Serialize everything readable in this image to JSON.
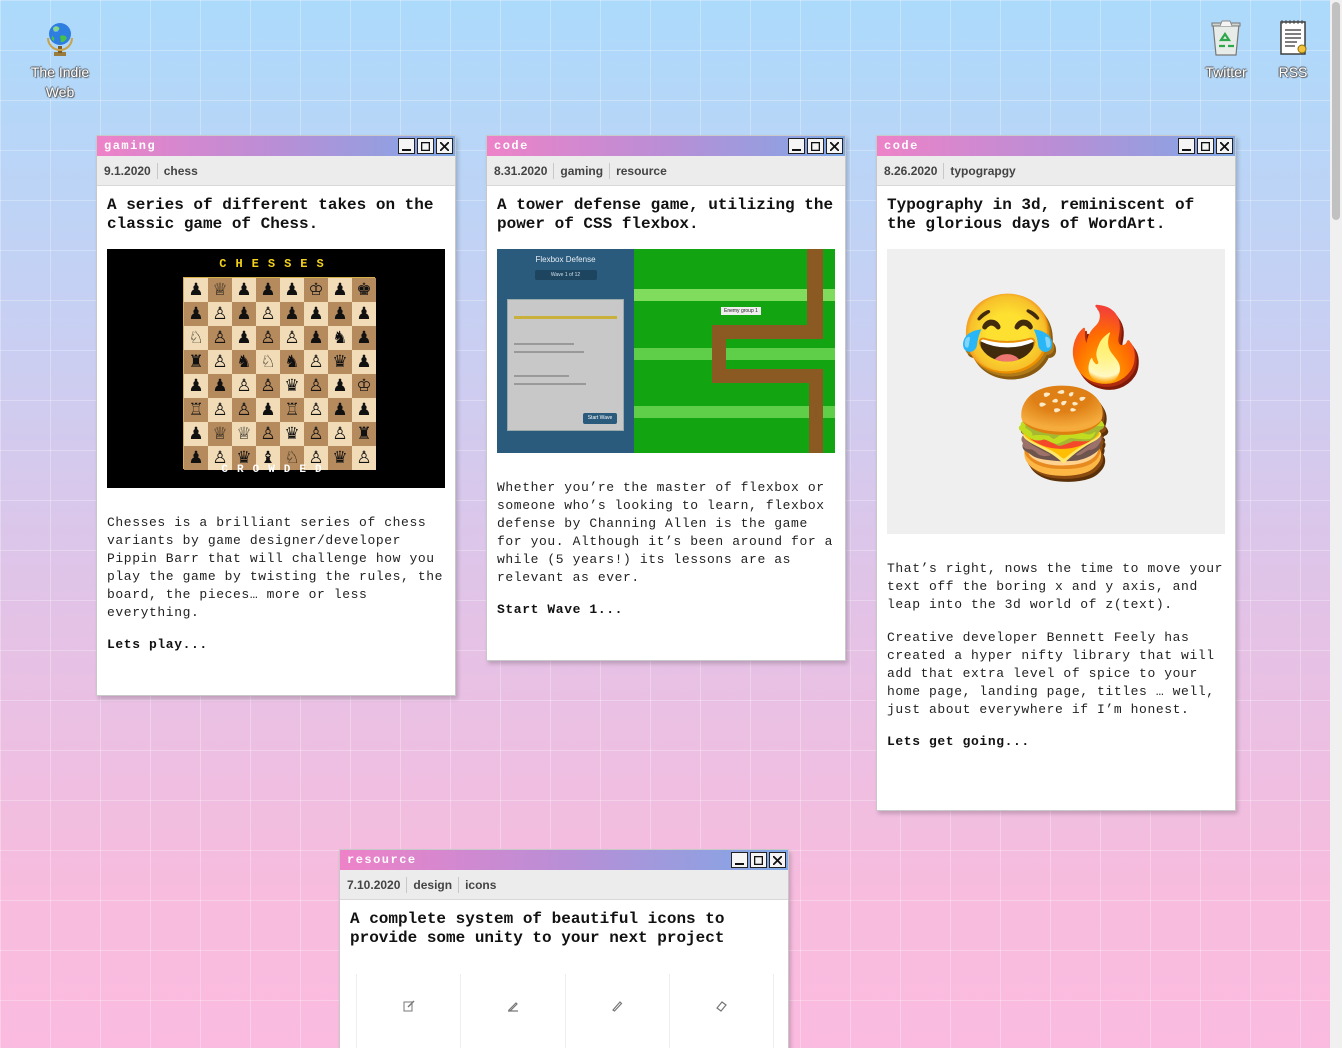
{
  "desktop": {
    "icons": [
      {
        "label": "The Indie Web",
        "icon": "globe-icon"
      },
      {
        "label": "Twitter",
        "icon": "recycle-bin-icon"
      },
      {
        "label": "RSS",
        "icon": "notepad-icon"
      }
    ]
  },
  "cards": [
    {
      "title": "gaming",
      "date": "9.1.2020",
      "tags": [
        "chess"
      ],
      "headline": "A series of different takes on the classic game of Chess.",
      "image": {
        "top_text": "CHESSES",
        "bottom_text": "CROWDED"
      },
      "paragraphs": [
        "Chesses is a brilliant series of chess variants by game designer/developer Pippin Barr that will challenge how you play the game by twisting the rules, the board, the pieces… more or less everything."
      ],
      "cta": "Lets play..."
    },
    {
      "title": "code",
      "date": "8.31.2020",
      "tags": [
        "gaming",
        "resource"
      ],
      "headline": "A tower defense game, utilizing the power of CSS flexbox.",
      "image": {
        "panel_title": "Flexbox Defense",
        "wave_label": "Wave 1 of 12",
        "button": "Start Wave",
        "enemy_label": "Enemy group 1"
      },
      "paragraphs": [
        "Whether you’re the master of flexbox or someone who’s looking to learn, flexbox defense by Channing Allen is the game for you. Although it’s been around for a while (5 years!) its lessons are as relevant as ever."
      ],
      "cta": "Start Wave 1..."
    },
    {
      "title": "code",
      "date": "8.26.2020",
      "tags": [
        "typograpgy"
      ],
      "headline": "Typography in 3d, reminiscent of the glorious days of WordArt.",
      "image": {
        "emoji": [
          "😂",
          "🔥",
          "🍔"
        ]
      },
      "paragraphs": [
        "That’s right, nows the time to move your text off the boring x and y axis, and leap into the 3d world of z(text).",
        "Creative developer Bennett Feely has created a hyper nifty library that will add that extra level of spice to your home page, landing page, titles … well, just about everywhere if I’m honest."
      ],
      "cta": "Lets get going..."
    },
    {
      "title": "resource",
      "date": "7.10.2020",
      "tags": [
        "design",
        "icons"
      ],
      "headline": "A complete system of beautiful icons to provide some unity to your next project",
      "image": {
        "icons": [
          "edit-icon",
          "pen-icon",
          "pencil-icon",
          "eraser-icon"
        ]
      },
      "paragraphs": [],
      "cta": ""
    }
  ]
}
